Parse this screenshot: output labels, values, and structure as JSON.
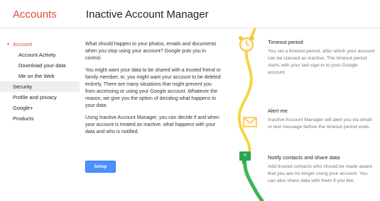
{
  "header": {
    "brand": "Accounts",
    "title": "Inactive Account Manager"
  },
  "sidebar": {
    "items": [
      {
        "label": "Account",
        "level": "parent",
        "active": false
      },
      {
        "label": "Account Activity",
        "level": "sub",
        "active": false
      },
      {
        "label": "Download your data",
        "level": "sub",
        "active": false
      },
      {
        "label": "Me on the Web",
        "level": "sub",
        "active": false
      },
      {
        "label": "Security",
        "level": "top",
        "active": true
      },
      {
        "label": "Profile and privacy",
        "level": "top",
        "active": false
      },
      {
        "label": "Google+",
        "level": "top",
        "active": false
      },
      {
        "label": "Products",
        "level": "top",
        "active": false
      }
    ]
  },
  "main": {
    "paragraphs": [
      "What should happen to your photos, emails and documents when you stop using your account? Google puts you in control.",
      "You might want your data to be shared with a trusted friend or family member, or, you might want your account to be deleted entirely. There are many situations that might prevent you from accessing or using your Google account. Whatever the reason, we give you the option of deciding what happens to your data.",
      "Using Inactive Account Manager, you can decide if and when your account is treated as inactive, what happens with your data and who is notified."
    ],
    "setup_label": "Setup"
  },
  "steps": [
    {
      "title": "Timeout period",
      "desc": "You set a timeout period, after which your account can be classed as inactive. The timeout period starts with your last sign-in to your Google account.",
      "icon": "alarm-clock-icon"
    },
    {
      "title": "Alert me",
      "desc": "Inactive Account Manager will alert you via email or text message before the timeout period ends.",
      "icon": "envelope-icon"
    },
    {
      "title": "Notify contacts and share data",
      "desc": "Add trusted contacts who should be made aware that you are no longer using your account. You can also share data with them if you like.",
      "icon": "speech-bubble-icon"
    }
  ],
  "colors": {
    "brand": "#dd4b39",
    "button": "#4d90fe",
    "timeline_yellow": "#f6d443",
    "timeline_green": "#3cb554"
  }
}
